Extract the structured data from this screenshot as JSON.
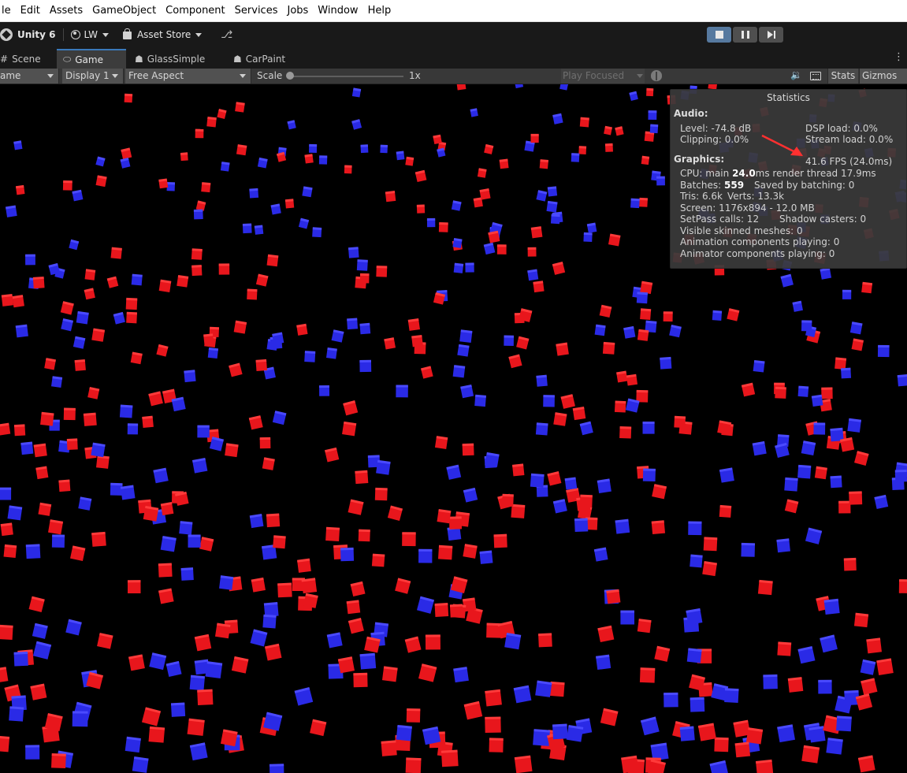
{
  "menu": [
    "le",
    "Edit",
    "Assets",
    "GameObject",
    "Component",
    "Services",
    "Jobs",
    "Window",
    "Help"
  ],
  "toolbar": {
    "unity_label": "Unity 6",
    "account_label": "LW",
    "asset_store_label": "Asset Store"
  },
  "tabs": [
    {
      "label": "Scene",
      "icon": "scene-icon",
      "active": false
    },
    {
      "label": "Game",
      "icon": "gamepad-icon",
      "active": true
    },
    {
      "label": "GlassSimple",
      "icon": "robot-icon",
      "active": false
    },
    {
      "label": "CarPaint",
      "icon": "robot-icon",
      "active": false
    }
  ],
  "game_toolbar": {
    "mode_label": "ame",
    "display_label": "Display 1",
    "aspect_label": "Free Aspect",
    "scale_label": "Scale",
    "scale_value": "1x",
    "scale_fraction": 0.0,
    "play_focused_label": "Play Focused",
    "stats_label": "Stats",
    "gizmos_label": "Gizmos"
  },
  "stats": {
    "title": "Statistics",
    "audio_header": "Audio:",
    "level": "Level: -74.8 dB",
    "dsp_load": "DSP load: 0.0%",
    "clipping": "Clipping: 0.0%",
    "stream_load": "Stream load: 0.0%",
    "fps": "41.6 FPS (24.0ms)",
    "graphics_header": "Graphics:",
    "cpu_prefix": "CPU: main ",
    "cpu_main": "24.0",
    "cpu_suffix": "ms  render thread 17.9ms",
    "batches_prefix": "Batches: ",
    "batches_value": "559",
    "saved_batching": "Saved by batching: 0",
    "tris": "Tris: 6.6k",
    "verts": "Verts: 13.3k",
    "screen": "Screen: 1176x894 - 12.0 MB",
    "setpass": "SetPass calls: 12",
    "shadow_casters": "Shadow casters: 0",
    "skinned": "Visible skinned meshes: 0",
    "animation": "Animation components playing: 0",
    "animator": "Animator components playing: 0"
  },
  "colors": {
    "red_cube": "#e8161c",
    "blue_cube": "#2a2ae6",
    "annotation_arrow": "#ff3030",
    "active_tab_accent": "#3a79bb",
    "play_active": "#56799f"
  }
}
